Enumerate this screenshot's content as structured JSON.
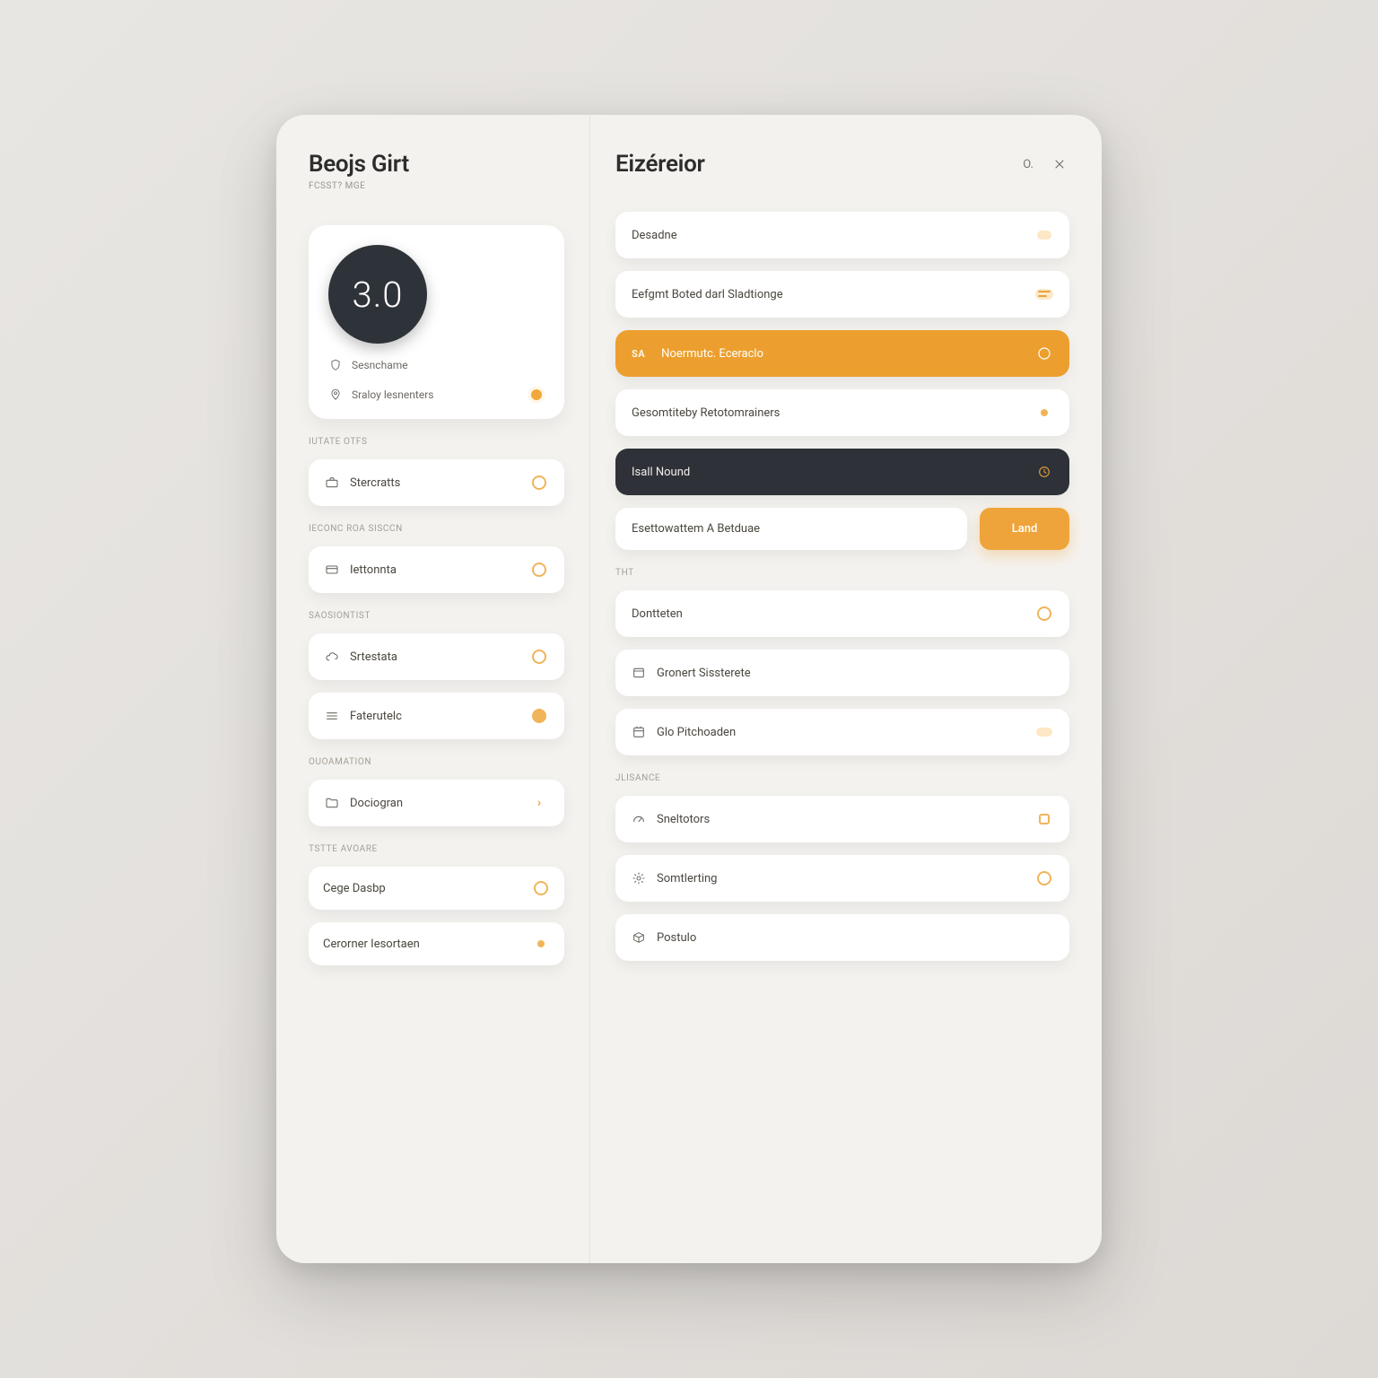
{
  "left": {
    "title": "Beojs Girt",
    "subtitle": "FCSST? MGE",
    "avatar_value": "3.0",
    "profile_line1": "Sesnchame",
    "profile_line2": "Sraloy lesnenters",
    "section1_label": "IUTATE OTFS",
    "item1": "Stercratts",
    "section2_label": "IECONC ROA SISCCN",
    "item2": "Iettonnta",
    "section3_label": "SAOSIONTIST",
    "item3": "Srtestata",
    "item4": "Faterutelc",
    "section4_label": "OUOAMATION",
    "item5": "Dociogran",
    "section5_label": "TSTTE AVOARE",
    "item6": "Cege Dasbp",
    "item7": "Cerorner Iesortaen"
  },
  "right": {
    "title": "Eizéreior",
    "action_label": "O.",
    "items": {
      "r1": "Desadne",
      "r2": "Eefgmt Boted darl Sladtionge",
      "r3_prefix": "SA",
      "r3": "Noermutc. Eceraclo",
      "r4": "Gesomtiteby Retotomrainers",
      "r5": "Isall Nound",
      "r6": "Esettowattem A Betduae",
      "r6_btn": "Land",
      "sec_a": "THT",
      "r7": "Dontteten",
      "r8": "Gronert Sissterete",
      "r9": "Glo Pitchoaden",
      "sec_b": "JLISANCE",
      "r10": "Sneltotors",
      "r11": "Somtlerting",
      "r12": "Postulo"
    }
  }
}
